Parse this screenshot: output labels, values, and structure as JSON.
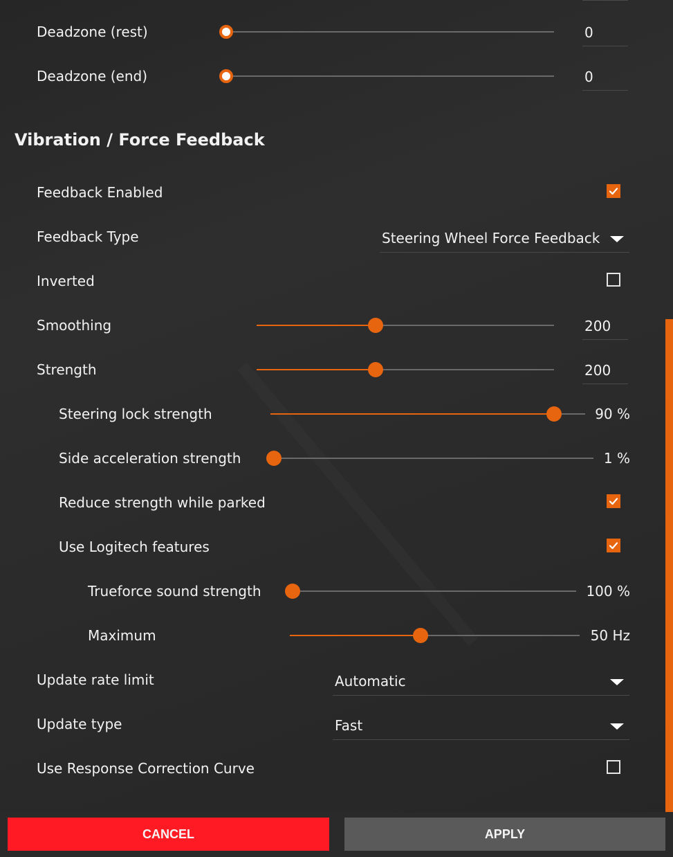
{
  "deadzone": [
    {
      "label": "Deadzone (rest)",
      "value": "0",
      "fraction": 0
    },
    {
      "label": "Deadzone (end)",
      "value": "0",
      "fraction": 0
    }
  ],
  "section": {
    "title": "Vibration / Force Feedback"
  },
  "feedback_enabled": {
    "label": "Feedback Enabled",
    "checked": true
  },
  "feedback_type": {
    "label": "Feedback Type",
    "value": "Steering Wheel Force Feedback"
  },
  "inverted": {
    "label": "Inverted",
    "checked": false
  },
  "smoothing": {
    "label": "Smoothing",
    "value": "200",
    "fraction": 0.4
  },
  "strength": {
    "label": "Strength",
    "value": "200",
    "fraction": 0.4
  },
  "steering_lock": {
    "label": "Steering lock strength",
    "value": "90 %",
    "fraction": 0.9
  },
  "side_accel": {
    "label": "Side acceleration strength",
    "value": "1 %",
    "fraction": 0.01
  },
  "reduce_parked": {
    "label": "Reduce strength while parked",
    "checked": true
  },
  "logitech": {
    "label": "Use Logitech features",
    "checked": true
  },
  "trueforce": {
    "label": "Trueforce sound strength",
    "value": "100 %",
    "fraction": 0
  },
  "maximum": {
    "label": "Maximum",
    "value": "50 Hz",
    "fraction": 0.45
  },
  "update_rate": {
    "label": "Update rate limit",
    "value": "Automatic"
  },
  "update_type": {
    "label": "Update type",
    "value": "Fast"
  },
  "response_curve": {
    "label": "Use Response Correction Curve",
    "checked": false
  },
  "buttons": {
    "cancel": "CANCEL",
    "apply": "APPLY"
  },
  "colors": {
    "accent": "#e8650f",
    "cancel": "#ff1a24",
    "apply": "#5a5a5a",
    "background": "#2a2a2a"
  }
}
